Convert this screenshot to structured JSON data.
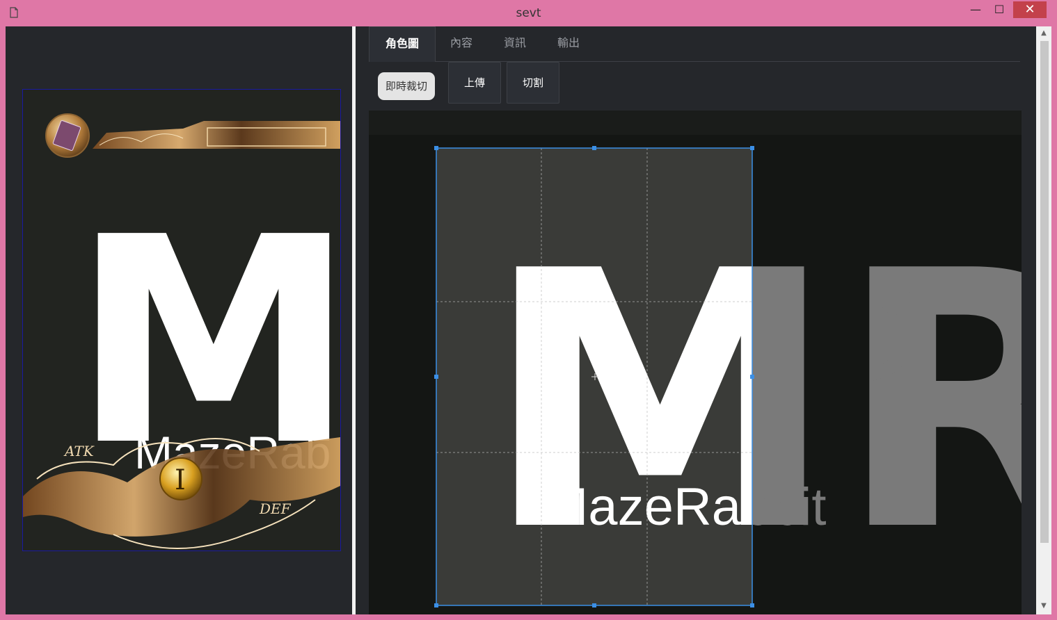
{
  "window": {
    "title": "sevt",
    "minimize_label": "—",
    "maximize_label": "☐",
    "close_label": "✕"
  },
  "tabs": [
    {
      "label": "角色圖",
      "active": true
    },
    {
      "label": "內容",
      "active": false
    },
    {
      "label": "資訊",
      "active": false
    },
    {
      "label": "輸出",
      "active": false
    }
  ],
  "toolbar": {
    "live_crop_label": "即時裁切",
    "upload_label": "上傳",
    "split_label": "切割"
  },
  "card_preview": {
    "logo_letters": "MR",
    "brand_text": "MazeRab",
    "atk_label": "ATK",
    "def_label": "DEF",
    "level_glyph": "I"
  },
  "crop_editor": {
    "logo_letters": "MR",
    "brand_text": "MazeRabbit"
  },
  "scrollbar": {
    "up_arrow": "▲",
    "down_arrow": "▼"
  },
  "colors": {
    "titlebar": "#df77a6",
    "close_button": "#c3414b",
    "background": "#25272b",
    "crop_border": "#3b8fe6",
    "gold": "#c98a3e"
  }
}
